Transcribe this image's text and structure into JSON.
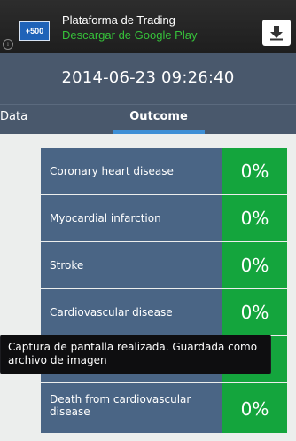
{
  "ad": {
    "logo_text": "+500",
    "title": "Plataforma de Trading",
    "subtitle": "Descargar de Google Play",
    "info_icon": "info-icon",
    "info_glyph": "i",
    "download_icon": "download-arrow-icon",
    "colors": {
      "subtitle": "#36c13a",
      "logo_bg": "#1f63b8"
    }
  },
  "header": {
    "timestamp": "2014-06-23 09:26:40"
  },
  "tabs": [
    {
      "label": "Data",
      "selected": false
    },
    {
      "label": "Outcome",
      "selected": true
    }
  ],
  "outcomes": [
    {
      "label": "Coronary heart disease",
      "value": "0%"
    },
    {
      "label": "Myocardial infarction",
      "value": "0%"
    },
    {
      "label": "Stroke",
      "value": "0%"
    },
    {
      "label": "Cardiovascular disease",
      "value": "0%"
    },
    {
      "label": "",
      "value": "0%"
    },
    {
      "label": "Death from cardiovascular disease",
      "value": "0%"
    }
  ],
  "toast": {
    "message": "Captura de pantalla realizada. Guardada como archivo de imagen"
  },
  "colors": {
    "header_bg": "#49586c",
    "row_bg": "#4a6585",
    "value_bg": "#14a53d",
    "tab_indicator": "#3e8fd6"
  }
}
